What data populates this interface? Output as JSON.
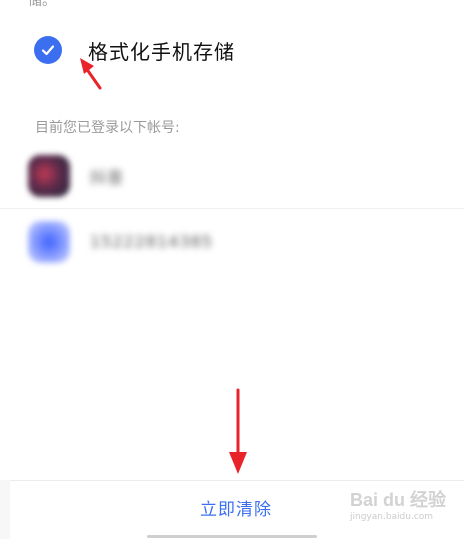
{
  "top_partial_text": "储。",
  "format_option": {
    "label": "格式化手机存储",
    "checked": true,
    "check_icon": "check-circle-icon",
    "accent_color": "#3b6ff0"
  },
  "accounts_section": {
    "title": "目前您已登录以下帐号:",
    "items": [
      {
        "name": "抖音",
        "avatar": "douyin-avatar"
      },
      {
        "name": "15222814385",
        "avatar": "app-avatar"
      }
    ]
  },
  "action": {
    "clear_label": "立即清除"
  },
  "annotations": {
    "arrow_color": "#e8232a"
  },
  "watermark": {
    "logo": "Bai du 经验",
    "url": "jingyan.baidu.com"
  }
}
